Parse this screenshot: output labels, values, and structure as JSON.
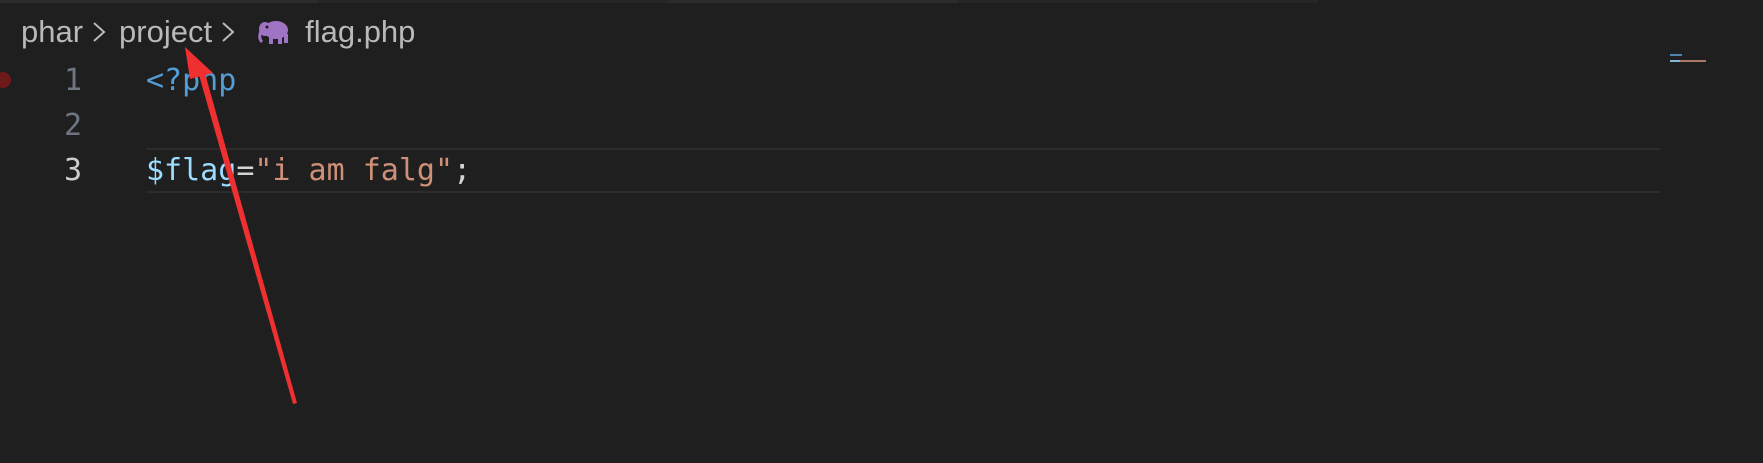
{
  "breadcrumb": {
    "folder1": "phar",
    "folder2": "project",
    "file": "flag.php",
    "file_icon": "php-elephant-icon"
  },
  "code": {
    "lines": [
      {
        "number": "1",
        "tokens": [
          "<?php"
        ]
      },
      {
        "number": "2",
        "tokens": []
      },
      {
        "number": "3",
        "tokens": [
          "$flag",
          "=",
          "\"i am falg\"",
          ";"
        ]
      }
    ],
    "current_line": "3",
    "breakpoint_line": "1"
  },
  "annotation": {
    "type": "arrow",
    "color": "#f03030",
    "points_to": "breadcrumb project"
  },
  "colors": {
    "background": "#1f1f1f",
    "keyword": "#569cd6",
    "variable": "#9cdcfe",
    "string": "#ce9178",
    "php_icon": "#a074c4"
  }
}
